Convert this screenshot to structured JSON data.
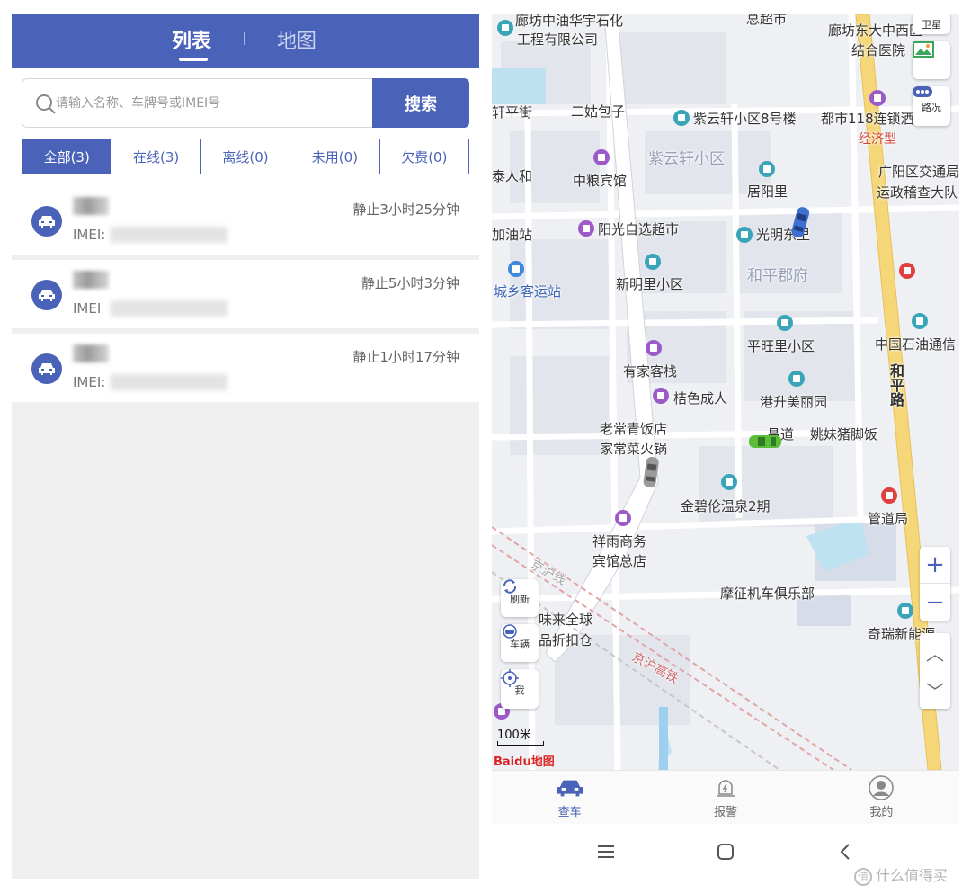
{
  "left": {
    "tabs": [
      {
        "label": "列表",
        "active": true
      },
      {
        "label": "地图",
        "active": false
      }
    ],
    "search": {
      "placeholder": "请输入名称、车牌号或IMEI号",
      "value": "",
      "button_label": "搜索"
    },
    "filters": [
      {
        "label": "全部(3)",
        "active": true
      },
      {
        "label": "在线(3)",
        "active": false
      },
      {
        "label": "离线(0)",
        "active": false
      },
      {
        "label": "未用(0)",
        "active": false
      },
      {
        "label": "欠费(0)",
        "active": false
      }
    ],
    "vehicles": [
      {
        "name": "",
        "imei_label": "IMEI:",
        "status": "静止3小时25分钟"
      },
      {
        "name": "",
        "imei_label": "IMEI",
        "status": "静止5小时3分钟"
      },
      {
        "name": "",
        "imei_label": "IMEI:",
        "status": "静止1小时17分钟"
      }
    ]
  },
  "map": {
    "labels": {
      "l1": "廊坊中油华宇石化",
      "l2": "工程有限公司",
      "l3": "廊坊东大中西医",
      "l4": "结合医院",
      "l5": "二姑包子",
      "l6": "紫云轩小区8号楼",
      "l7": "都市118连锁酒",
      "l8": "经济型",
      "l9": "紫云轩小区",
      "l10": "中粮宾馆",
      "l11": "居阳里",
      "l12": "广阳区交通局",
      "l13": "运政稽查大队",
      "l14": "加油站",
      "l15": "阳光自选超市",
      "l16": "光明东里",
      "l17": "城乡客运站",
      "l18": "新明里小区",
      "l19": "和平郡府",
      "l20": "平旺里小区",
      "l21": "中国石油通信",
      "l22": "有家客栈",
      "l23": "桔色成人",
      "l24": "港升美丽园",
      "l25": "和平路",
      "l26": "老常青饭店",
      "l27": "家常菜火锅",
      "l28": "昌道",
      "l29": "姚妹猪脚饭",
      "l30": "金碧伦温泉2期",
      "l31": "管道局",
      "l32": "祥雨商务",
      "l33": "宾馆总店",
      "l34": "京沪线",
      "l35": "摩征机车俱乐部",
      "l36": "味来全球",
      "l37": "品折扣仓",
      "l38": "京沪高铁",
      "l39": "奇瑞新能源",
      "l40": "轩平街",
      "l41": "泰人和",
      "l42": "总超市"
    },
    "controls": {
      "satellite": "卫星",
      "traffic": "路况",
      "refresh": "刷新",
      "vehicle": "车辆",
      "me": "我"
    },
    "scale": "100米",
    "logo": "Baidu地图"
  },
  "bottom_nav": [
    {
      "label": "查车",
      "active": true
    },
    {
      "label": "报警",
      "active": false
    },
    {
      "label": "我的",
      "active": false
    }
  ],
  "watermark": "什么值得买",
  "colors": {
    "primary": "#4a63b8",
    "road_yellow": "#f5d77a",
    "map_bg": "#eef0f4"
  }
}
